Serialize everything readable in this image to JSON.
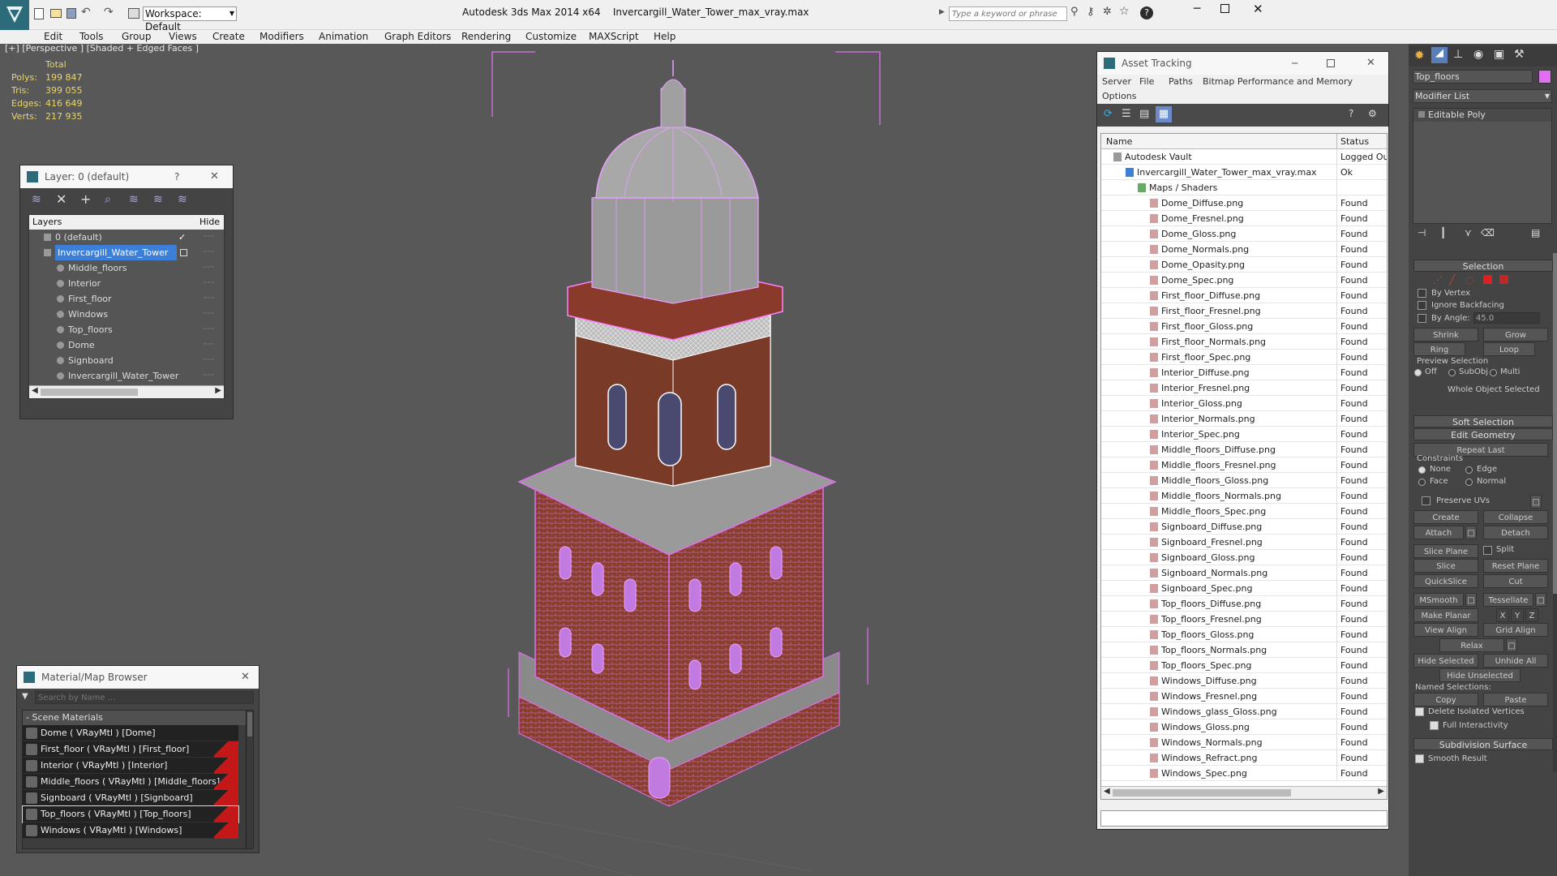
{
  "app": {
    "title": "Autodesk 3ds Max  2014 x64",
    "file": "Invercargill_Water_Tower_max_vray.max",
    "workspace": "Workspace: Default",
    "search_placeholder": "Type a keyword or phrase"
  },
  "menu": [
    "Edit",
    "Tools",
    "Group",
    "Views",
    "Create",
    "Modifiers",
    "Animation",
    "Graph Editors",
    "Rendering",
    "Customize",
    "MAXScript",
    "Help"
  ],
  "viewport": {
    "label": "[+] [Perspective ] [Shaded + Edged Faces ]",
    "stats": {
      "header": "Total",
      "rows": [
        {
          "k": "Polys:",
          "v": "199 847"
        },
        {
          "k": "Tris:",
          "v": "399 055"
        },
        {
          "k": "Edges:",
          "v": "416 649"
        },
        {
          "k": "Verts:",
          "v": "217 935"
        }
      ]
    }
  },
  "layer_panel": {
    "title": "Layer: 0 (default)",
    "help": "?",
    "col_layers": "Layers",
    "col_hide": "Hide",
    "rows": [
      {
        "name": "0 (default)",
        "level": 0
      },
      {
        "name": "Invercargill_Water_Tower",
        "level": 0,
        "selected": true
      },
      {
        "name": "Middle_floors",
        "level": 1
      },
      {
        "name": "Interior",
        "level": 1
      },
      {
        "name": "First_floor",
        "level": 1
      },
      {
        "name": "Windows",
        "level": 1
      },
      {
        "name": "Top_floors",
        "level": 1
      },
      {
        "name": "Dome",
        "level": 1
      },
      {
        "name": "Signboard",
        "level": 1
      },
      {
        "name": "Invercargill_Water_Tower",
        "level": 1
      }
    ]
  },
  "material_browser": {
    "title": "Material/Map Browser",
    "search_placeholder": "Search by Name ...",
    "section": "- Scene Materials",
    "items": [
      {
        "label": "Dome  ( VRayMtl )  [Dome]",
        "red": false
      },
      {
        "label": "First_floor  ( VRayMtl )  [First_floor]",
        "red": true
      },
      {
        "label": "Interior  ( VRayMtl )  [Interior]",
        "red": true
      },
      {
        "label": "Middle_floors  ( VRayMtl )  [Middle_floors]",
        "red": true
      },
      {
        "label": "Signboard  ( VRayMtl )  [Signboard]",
        "red": true
      },
      {
        "label": "Top_floors  ( VRayMtl )  [Top_floors]",
        "red": true,
        "selected": true
      },
      {
        "label": "Windows  ( VRayMtl )  [Windows]",
        "red": true
      }
    ]
  },
  "asset_tracking": {
    "title": "Asset Tracking",
    "menu": [
      "Server",
      "File",
      "Paths",
      "Bitmap Performance and Memory"
    ],
    "menu2": "Options",
    "col_name": "Name",
    "col_status": "Status",
    "rows": [
      {
        "name": "Autodesk Vault",
        "status": "Logged Out",
        "indent": 1
      },
      {
        "name": "Invercargill_Water_Tower_max_vray.max",
        "status": "Ok",
        "indent": 2
      },
      {
        "name": "Maps / Shaders",
        "status": "",
        "indent": 3
      },
      {
        "name": "Dome_Diffuse.png",
        "status": "Found",
        "indent": 4
      },
      {
        "name": "Dome_Fresnel.png",
        "status": "Found",
        "indent": 4
      },
      {
        "name": "Dome_Gloss.png",
        "status": "Found",
        "indent": 4
      },
      {
        "name": "Dome_Normals.png",
        "status": "Found",
        "indent": 4
      },
      {
        "name": "Dome_Opasity.png",
        "status": "Found",
        "indent": 4
      },
      {
        "name": "Dome_Spec.png",
        "status": "Found",
        "indent": 4
      },
      {
        "name": "First_floor_Diffuse.png",
        "status": "Found",
        "indent": 4
      },
      {
        "name": "First_floor_Fresnel.png",
        "status": "Found",
        "indent": 4
      },
      {
        "name": "First_floor_Gloss.png",
        "status": "Found",
        "indent": 4
      },
      {
        "name": "First_floor_Normals.png",
        "status": "Found",
        "indent": 4
      },
      {
        "name": "First_floor_Spec.png",
        "status": "Found",
        "indent": 4
      },
      {
        "name": "Interior_Diffuse.png",
        "status": "Found",
        "indent": 4
      },
      {
        "name": "Interior_Fresnel.png",
        "status": "Found",
        "indent": 4
      },
      {
        "name": "Interior_Gloss.png",
        "status": "Found",
        "indent": 4
      },
      {
        "name": "Interior_Normals.png",
        "status": "Found",
        "indent": 4
      },
      {
        "name": "Interior_Spec.png",
        "status": "Found",
        "indent": 4
      },
      {
        "name": "Middle_floors_Diffuse.png",
        "status": "Found",
        "indent": 4
      },
      {
        "name": "Middle_floors_Fresnel.png",
        "status": "Found",
        "indent": 4
      },
      {
        "name": "Middle_floors_Gloss.png",
        "status": "Found",
        "indent": 4
      },
      {
        "name": "Middle_floors_Normals.png",
        "status": "Found",
        "indent": 4
      },
      {
        "name": "Middle_floors_Spec.png",
        "status": "Found",
        "indent": 4
      },
      {
        "name": "Signboard_Diffuse.png",
        "status": "Found",
        "indent": 4
      },
      {
        "name": "Signboard_Fresnel.png",
        "status": "Found",
        "indent": 4
      },
      {
        "name": "Signboard_Gloss.png",
        "status": "Found",
        "indent": 4
      },
      {
        "name": "Signboard_Normals.png",
        "status": "Found",
        "indent": 4
      },
      {
        "name": "Signboard_Spec.png",
        "status": "Found",
        "indent": 4
      },
      {
        "name": "Top_floors_Diffuse.png",
        "status": "Found",
        "indent": 4
      },
      {
        "name": "Top_floors_Fresnel.png",
        "status": "Found",
        "indent": 4
      },
      {
        "name": "Top_floors_Gloss.png",
        "status": "Found",
        "indent": 4
      },
      {
        "name": "Top_floors_Normals.png",
        "status": "Found",
        "indent": 4
      },
      {
        "name": "Top_floors_Spec.png",
        "status": "Found",
        "indent": 4
      },
      {
        "name": "Windows_Diffuse.png",
        "status": "Found",
        "indent": 4
      },
      {
        "name": "Windows_Fresnel.png",
        "status": "Found",
        "indent": 4
      },
      {
        "name": "Windows_glass_Gloss.png",
        "status": "Found",
        "indent": 4
      },
      {
        "name": "Windows_Gloss.png",
        "status": "Found",
        "indent": 4
      },
      {
        "name": "Windows_Normals.png",
        "status": "Found",
        "indent": 4
      },
      {
        "name": "Windows_Refract.png",
        "status": "Found",
        "indent": 4
      },
      {
        "name": "Windows_Spec.png",
        "status": "Found",
        "indent": 4
      }
    ]
  },
  "command_panel": {
    "object_name": "Top_floors",
    "modifier_list": "Modifier List",
    "stack_item": "Editable Poly",
    "selection": {
      "title": "Selection",
      "by_vertex": "By Vertex",
      "ignore_backfacing": "Ignore Backfacing",
      "by_angle": "By Angle:",
      "angle_value": "45.0",
      "shrink": "Shrink",
      "grow": "Grow",
      "ring": "Ring",
      "loop": "Loop",
      "preview_selection": "Preview Selection",
      "off": "Off",
      "subobj": "SubObj",
      "multi": "Multi",
      "status": "Whole Object Selected"
    },
    "soft_selection": "Soft Selection",
    "edit_geometry": {
      "title": "Edit Geometry",
      "repeat_last": "Repeat Last",
      "constraints": "Constraints",
      "none": "None",
      "edge": "Edge",
      "face": "Face",
      "normal": "Normal",
      "preserve_uvs": "Preserve UVs",
      "create": "Create",
      "collapse": "Collapse",
      "attach": "Attach",
      "detach": "Detach",
      "slice_plane": "Slice Plane",
      "split": "Split",
      "slice": "Slice",
      "reset_plane": "Reset Plane",
      "quickslice": "QuickSlice",
      "cut": "Cut",
      "msmooth": "MSmooth",
      "tessellate": "Tessellate",
      "make_planar": "Make Planar",
      "x": "X",
      "y": "Y",
      "z": "Z",
      "view_align": "View Align",
      "grid_align": "Grid Align",
      "relax": "Relax",
      "hide_selected": "Hide Selected",
      "unhide_all": "Unhide All",
      "hide_unselected": "Hide Unselected",
      "named_selections": "Named Selections:",
      "copy": "Copy",
      "paste": "Paste",
      "delete_isolated": "Delete Isolated Vertices",
      "full_interactivity": "Full Interactivity"
    },
    "subdivision_surface": "Subdivision Surface",
    "smooth_result": "Smooth Result"
  },
  "colors": {
    "accent": "#3b7fd9",
    "object_color": "#e070f0",
    "selection_magenta": "#ff66ff",
    "stat_yellow": "#e8d66a",
    "found_text": "#222222"
  }
}
